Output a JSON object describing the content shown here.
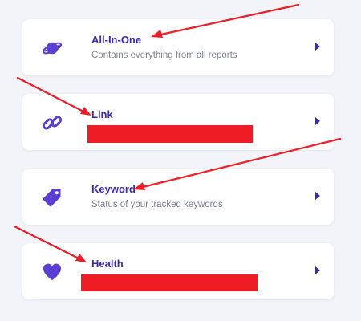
{
  "reports": [
    {
      "title": "All-In-One",
      "subtitle": "Contains everything from all reports",
      "icon": "planet-icon"
    },
    {
      "title": "Link",
      "subtitle": "",
      "icon": "link-icon"
    },
    {
      "title": "Keyword",
      "subtitle": "Status of your tracked keywords",
      "icon": "tag-icon"
    },
    {
      "title": "Health",
      "subtitle": "",
      "icon": "heart-icon"
    }
  ],
  "colors": {
    "accent": "#5b3fd4",
    "title": "#3a2ab3",
    "subtitle": "#7a7f93",
    "background": "#f3f4f9",
    "annotation_red": "#ee1c25"
  }
}
